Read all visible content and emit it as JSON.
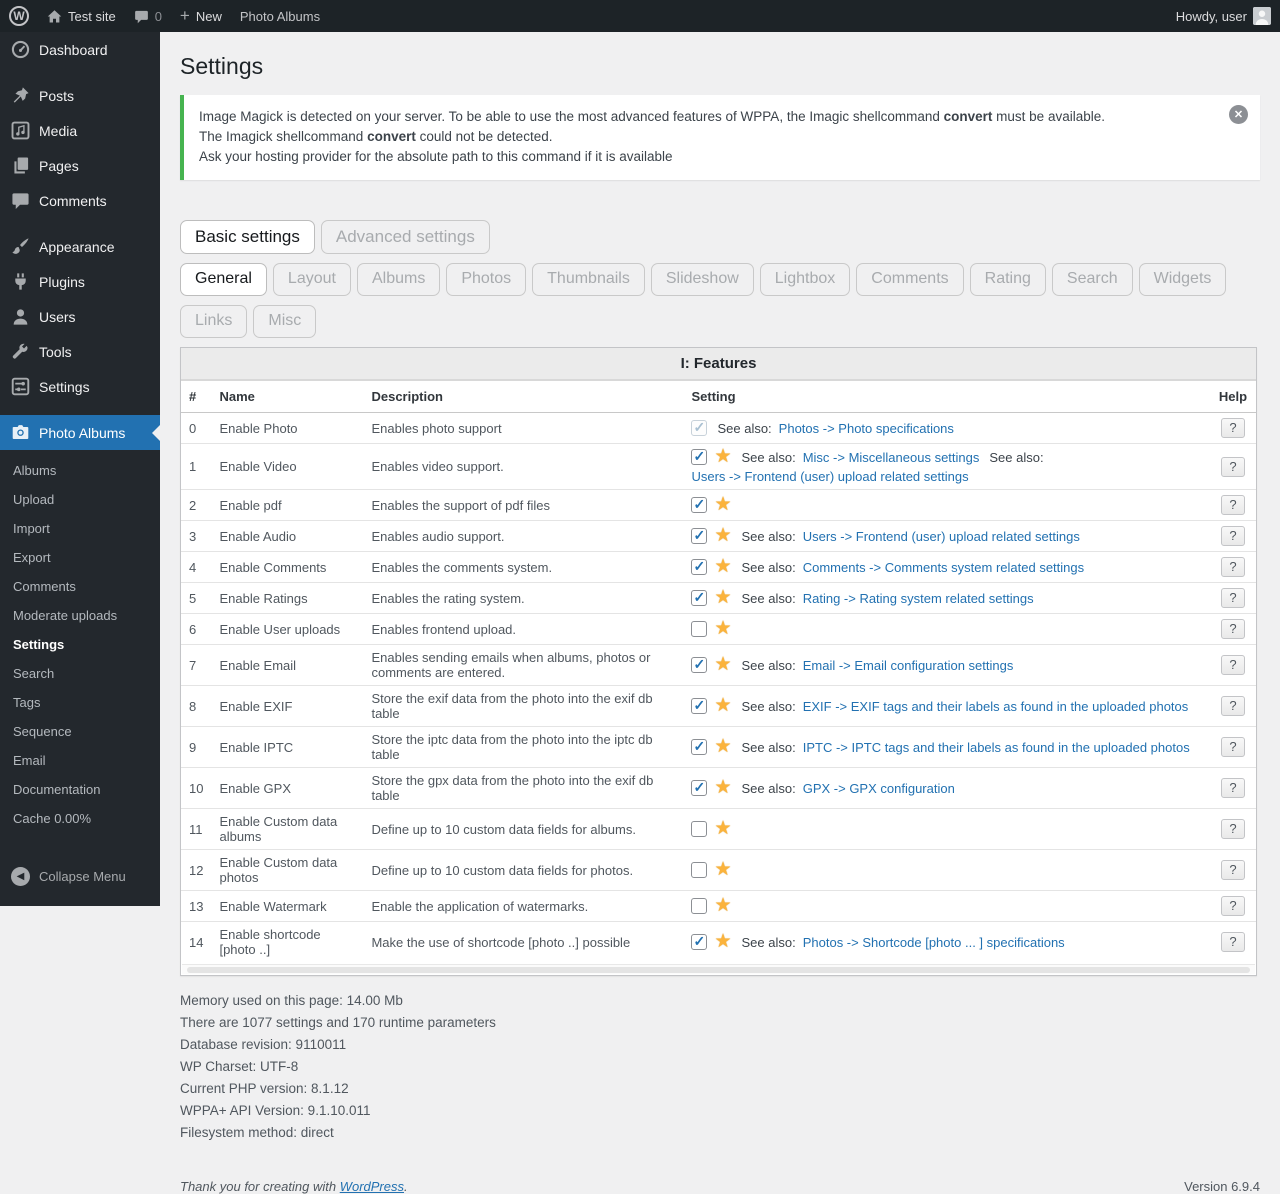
{
  "admin_bar": {
    "site_name": "Test site",
    "comments_count": "0",
    "new_label": "New",
    "page_label": "Photo Albums",
    "howdy": "Howdy, user"
  },
  "sidebar": {
    "items": [
      {
        "label": "Dashboard",
        "icon": "dashboard-icon",
        "gap": false,
        "active": false
      },
      {
        "label": "Posts",
        "icon": "pin-icon",
        "gap": true,
        "active": false
      },
      {
        "label": "Media",
        "icon": "media-icon",
        "gap": false,
        "active": false
      },
      {
        "label": "Pages",
        "icon": "pages-icon",
        "gap": false,
        "active": false
      },
      {
        "label": "Comments",
        "icon": "comment-icon",
        "gap": false,
        "active": false
      },
      {
        "label": "Appearance",
        "icon": "brush-icon",
        "gap": true,
        "active": false
      },
      {
        "label": "Plugins",
        "icon": "plug-icon",
        "gap": false,
        "active": false
      },
      {
        "label": "Users",
        "icon": "user-icon",
        "gap": false,
        "active": false
      },
      {
        "label": "Tools",
        "icon": "wrench-icon",
        "gap": false,
        "active": false
      },
      {
        "label": "Settings",
        "icon": "sliders-icon",
        "gap": false,
        "active": false
      },
      {
        "label": "Photo Albums",
        "icon": "camera-icon",
        "gap": true,
        "active": true
      }
    ],
    "submenu": [
      {
        "label": "Albums",
        "current": false
      },
      {
        "label": "Upload",
        "current": false
      },
      {
        "label": "Import",
        "current": false
      },
      {
        "label": "Export",
        "current": false
      },
      {
        "label": "Comments",
        "current": false
      },
      {
        "label": "Moderate uploads",
        "current": false
      },
      {
        "label": "Settings",
        "current": true
      },
      {
        "label": "Search",
        "current": false
      },
      {
        "label": "Tags",
        "current": false
      },
      {
        "label": "Sequence",
        "current": false
      },
      {
        "label": "Email",
        "current": false
      },
      {
        "label": "Documentation",
        "current": false
      },
      {
        "label": "Cache 0.00%",
        "current": false
      }
    ],
    "collapse": "Collapse Menu"
  },
  "page": {
    "title": "Settings",
    "notice": {
      "line1_pre": "Image Magick is detected on your server. To be able to use the most advanced features of WPPA, the Imagic shellcommand ",
      "line1_bold": "convert",
      "line1_post": " must be available.",
      "line2_pre": "The Imagick shellcommand ",
      "line2_bold": "convert",
      "line2_post": " could not be detected.",
      "line3": "Ask your hosting provider for the absolute path to this command if it is available"
    },
    "tabs_primary": [
      {
        "label": "Basic settings",
        "active": true
      },
      {
        "label": "Advanced settings",
        "active": false
      }
    ],
    "tabs_secondary": [
      {
        "label": "General",
        "active": true
      },
      {
        "label": "Layout",
        "active": false
      },
      {
        "label": "Albums",
        "active": false
      },
      {
        "label": "Photos",
        "active": false
      },
      {
        "label": "Thumbnails",
        "active": false
      },
      {
        "label": "Slideshow",
        "active": false
      },
      {
        "label": "Lightbox",
        "active": false
      },
      {
        "label": "Comments",
        "active": false
      },
      {
        "label": "Rating",
        "active": false
      },
      {
        "label": "Search",
        "active": false
      },
      {
        "label": "Widgets",
        "active": false
      },
      {
        "label": "Links",
        "active": false
      },
      {
        "label": "Misc",
        "active": false
      }
    ],
    "table": {
      "title": "I: Features",
      "columns": [
        "#",
        "Name",
        "Description",
        "Setting",
        "Help"
      ],
      "help_label": "?",
      "see_also_label": "See also:",
      "rows": [
        {
          "num": "0",
          "name": "Enable Photo",
          "desc": "Enables photo support",
          "checked": true,
          "disabled": true,
          "star": false,
          "links": [
            "Photos -> Photo specifications"
          ]
        },
        {
          "num": "1",
          "name": "Enable Video",
          "desc": "Enables video support.",
          "checked": true,
          "disabled": false,
          "star": true,
          "links": [
            "Misc -> Miscellaneous settings",
            "Users -> Frontend (user) upload related settings"
          ]
        },
        {
          "num": "2",
          "name": "Enable pdf",
          "desc": "Enables the support of pdf files",
          "checked": true,
          "disabled": false,
          "star": true,
          "links": []
        },
        {
          "num": "3",
          "name": "Enable Audio",
          "desc": "Enables audio support.",
          "checked": true,
          "disabled": false,
          "star": true,
          "links": [
            "Users -> Frontend (user) upload related settings"
          ]
        },
        {
          "num": "4",
          "name": "Enable Comments",
          "desc": "Enables the comments system.",
          "checked": true,
          "disabled": false,
          "star": true,
          "links": [
            "Comments -> Comments system related settings"
          ]
        },
        {
          "num": "5",
          "name": "Enable Ratings",
          "desc": "Enables the rating system.",
          "checked": true,
          "disabled": false,
          "star": true,
          "links": [
            "Rating -> Rating system related settings"
          ]
        },
        {
          "num": "6",
          "name": "Enable User uploads",
          "desc": "Enables frontend upload.",
          "checked": false,
          "disabled": false,
          "star": true,
          "links": []
        },
        {
          "num": "7",
          "name": "Enable Email",
          "desc": "Enables sending emails when albums, photos or comments are entered.",
          "checked": true,
          "disabled": false,
          "star": true,
          "links": [
            "Email -> Email configuration settings"
          ]
        },
        {
          "num": "8",
          "name": "Enable EXIF",
          "desc": "Store the exif data from the photo into the exif db table",
          "checked": true,
          "disabled": false,
          "star": true,
          "links": [
            "EXIF -> EXIF tags and their labels as found in the uploaded photos"
          ]
        },
        {
          "num": "9",
          "name": "Enable IPTC",
          "desc": "Store the iptc data from the photo into the iptc db table",
          "checked": true,
          "disabled": false,
          "star": true,
          "links": [
            "IPTC -> IPTC tags and their labels as found in the uploaded photos"
          ]
        },
        {
          "num": "10",
          "name": "Enable GPX",
          "desc": "Store the gpx data from the photo into the exif db table",
          "checked": true,
          "disabled": false,
          "star": true,
          "links": [
            "GPX -> GPX configuration"
          ]
        },
        {
          "num": "11",
          "name": "Enable Custom data albums",
          "desc": "Define up to 10 custom data fields for albums.",
          "checked": false,
          "disabled": false,
          "star": true,
          "links": []
        },
        {
          "num": "12",
          "name": "Enable Custom data photos",
          "desc": "Define up to 10 custom data fields for photos.",
          "checked": false,
          "disabled": false,
          "star": true,
          "links": []
        },
        {
          "num": "13",
          "name": "Enable Watermark",
          "desc": "Enable the application of watermarks.",
          "checked": false,
          "disabled": false,
          "star": true,
          "links": []
        },
        {
          "num": "14",
          "name": "Enable shortcode [photo ..]",
          "desc": "Make the use of shortcode [photo ..] possible",
          "checked": true,
          "disabled": false,
          "star": true,
          "links": [
            "Photos -> Shortcode [photo ... ] specifications"
          ]
        }
      ]
    },
    "info_lines": [
      "Memory used on this page: 14.00 Mb",
      "There are 1077 settings and 170 runtime parameters",
      "Database revision: 9110011",
      "WP Charset: UTF-8",
      "Current PHP version: 8.1.12",
      "WPPA+ API Version: 9.1.10.011",
      "Filesystem method: direct"
    ],
    "footer": {
      "thanks_pre": "Thank you for creating with ",
      "thanks_link": "WordPress",
      "thanks_post": ".",
      "version": "Version 6.9.4"
    }
  },
  "colors": {
    "accent_blue": "#2271b1",
    "notice_green": "#46b450",
    "star_gold": "#fbb33c",
    "adminbar_bg": "#1d2327",
    "sidebar_bg": "#23282d"
  }
}
